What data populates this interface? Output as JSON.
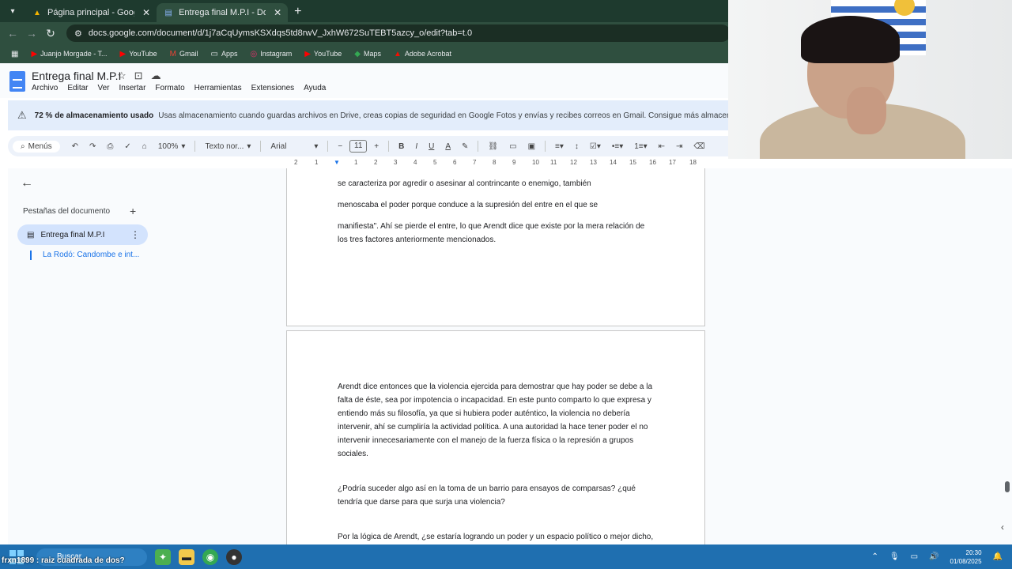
{
  "browser": {
    "tabs": [
      {
        "title": "Página principal - Google Drive",
        "icon": "drive-icon",
        "active": false
      },
      {
        "title": "Entrega final M.P.I - Documento",
        "icon": "docs-icon",
        "active": true
      }
    ],
    "url": "docs.google.com/document/d/1j7aCqUymsKSXdqs5td8rwV_JxhW672SuTEBT5azcy_o/edit?tab=t.0",
    "bookmarks": [
      {
        "label": "Juanjo Morgade - T...",
        "icon": "youtube-icon"
      },
      {
        "label": "YouTube",
        "icon": "youtube-icon"
      },
      {
        "label": "Gmail",
        "icon": "gmail-icon"
      },
      {
        "label": "Apps",
        "icon": "folder-icon"
      },
      {
        "label": "Instagram",
        "icon": "instagram-icon"
      },
      {
        "label": "YouTube",
        "icon": "youtube-icon"
      },
      {
        "label": "Maps",
        "icon": "maps-icon"
      },
      {
        "label": "Adobe Acrobat",
        "icon": "acrobat-icon"
      }
    ]
  },
  "doc": {
    "title": "Entrega final M.P.I",
    "menus": [
      "Archivo",
      "Editar",
      "Ver",
      "Insertar",
      "Formato",
      "Herramientas",
      "Extensiones",
      "Ayuda"
    ]
  },
  "banner": {
    "bold": "72 % de almacenamiento usado",
    "text": "Usas almacenamiento cuando guardas archivos en Drive, creas copias de seguridad en Google Fotos y envías y recibes correos en Gmail. Consigue más almacenamien"
  },
  "toolbar": {
    "menus_label": "Menús",
    "zoom": "100%",
    "style": "Texto nor...",
    "font": "Arial",
    "size": "11"
  },
  "ruler": [
    "2",
    "1",
    "1",
    "2",
    "3",
    "4",
    "5",
    "6",
    "7",
    "8",
    "9",
    "10",
    "11",
    "12",
    "13",
    "14",
    "15",
    "16",
    "17",
    "18"
  ],
  "sidebar": {
    "header": "Pestañas del documento",
    "tabs": [
      {
        "label": "Entrega final M.P.I"
      },
      {
        "label": "La Rodó: Candombe e int..."
      }
    ]
  },
  "page1": {
    "lines": [
      "se caracteriza por agredir o asesinar al contrincante o enemigo, también",
      "menoscaba el poder porque conduce a la supresión del entre en el que se",
      "manifiesta\". Ahí se pierde el entre, lo que Arendt dice que existe por la mera relación de los tres factores anteriormente mencionados."
    ]
  },
  "page2": {
    "p1": "Arendt dice entonces que la violencia ejercida para demostrar que hay poder se debe a la falta de éste, sea por impotencia o incapacidad. En este punto comparto lo que expresa y entiendo más su filosofía, ya que si hubiera poder auténtico, la violencia no debería intervenir, ahí se cumpliría la actividad política. A una autoridad la hace tener poder el no intervenir innecesariamente con el manejo de la fuerza física o la represión a grupos sociales.",
    "p2": "¿Podría suceder algo así en la toma de un barrio para ensayos de comparsas? ¿qué tendría que darse para que surja una violencia?",
    "p3": "Por la lógica de Arendt, ¿se estaría logrando un poder y un espacio político o mejor dicho,"
  },
  "taskbar": {
    "search": "Buscar",
    "overlay": "frxn1899 : raiz cuadrada de dos?",
    "time": "20:30",
    "date": "01/08/2025"
  }
}
